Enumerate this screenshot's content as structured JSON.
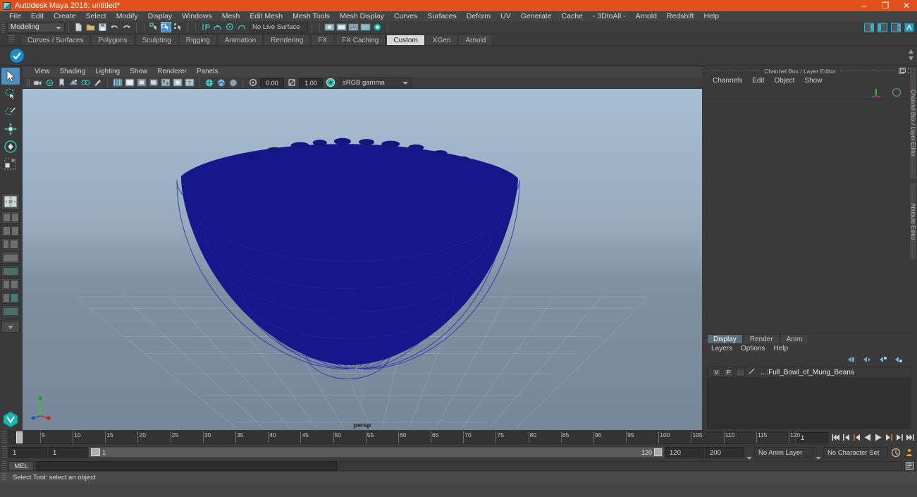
{
  "window": {
    "title": "Autodesk Maya 2016: untitled*",
    "minimize": "–",
    "maximize": "❐",
    "close": "✕"
  },
  "menubar": {
    "items": [
      "File",
      "Edit",
      "Create",
      "Select",
      "Modify",
      "Display",
      "Windows",
      "Mesh",
      "Edit Mesh",
      "Mesh Tools",
      "Mesh Display",
      "Curves",
      "Surfaces",
      "Deform",
      "UV",
      "Generate",
      "Cache",
      "- 3DtoAll -",
      "Arnold",
      "Redshift",
      "Help"
    ]
  },
  "statusbar": {
    "menu_set": "Modeling",
    "live_surface": "No Live Surface"
  },
  "shelf": {
    "tabs": [
      "Curves / Surfaces",
      "Polygons",
      "Sculpting",
      "Rigging",
      "Animation",
      "Rendering",
      "FX",
      "FX Caching",
      "Custom",
      "XGen",
      "Arnold"
    ],
    "active_tab": "Custom"
  },
  "viewport": {
    "menus": [
      "View",
      "Shading",
      "Lighting",
      "Show",
      "Renderer",
      "Panels"
    ],
    "exposure": "0.00",
    "gamma": "1.00",
    "color_profile": "sRGB gamma",
    "camera_label": "persp",
    "object_color": "#17178c",
    "wireframe_color": "#2b2bb0",
    "bg_top": "#a6bcd2",
    "bg_bottom": "#75869a",
    "grid_color": "#9aa8b6"
  },
  "channel_box": {
    "panel_title": "Channel Box / Layer Editor",
    "menus": [
      "Channels",
      "Edit",
      "Object",
      "Show"
    ],
    "side_tabs": [
      "Channel Box / Layer Editor",
      "Attribute Editor"
    ]
  },
  "layer_editor": {
    "tabs": [
      "Display",
      "Render",
      "Anim"
    ],
    "active_tab": "Display",
    "menus": [
      "Layers",
      "Options",
      "Help"
    ],
    "layers": [
      {
        "visible": "V",
        "playback": "P",
        "name": "...:Full_Bowl_of_Mung_Beans"
      }
    ]
  },
  "timeline": {
    "ticks": [
      1,
      5,
      10,
      15,
      20,
      25,
      30,
      35,
      40,
      45,
      50,
      55,
      60,
      65,
      70,
      75,
      80,
      85,
      90,
      95,
      100,
      105,
      110,
      115,
      120
    ],
    "current_frame": "1",
    "start": 1,
    "end": 120
  },
  "range": {
    "anim_start": "1",
    "playback_start": "1",
    "slider_start_label": "1",
    "slider_end_label": "120",
    "playback_end": "120",
    "anim_end": "200",
    "anim_layer": "No Anim Layer",
    "character_set": "No Character Set"
  },
  "command_line": {
    "language": "MEL",
    "input_value": "",
    "output_value": ""
  },
  "help_line": {
    "text": "Select Tool: select an object"
  },
  "toolbox": {
    "tools": [
      {
        "name": "select-tool",
        "active": true
      },
      {
        "name": "lasso-select-tool",
        "active": false
      },
      {
        "name": "paint-select-tool",
        "active": false
      },
      {
        "name": "move-tool",
        "active": false
      },
      {
        "name": "rotate-tool",
        "active": false
      },
      {
        "name": "scale-tool",
        "active": false
      }
    ]
  }
}
